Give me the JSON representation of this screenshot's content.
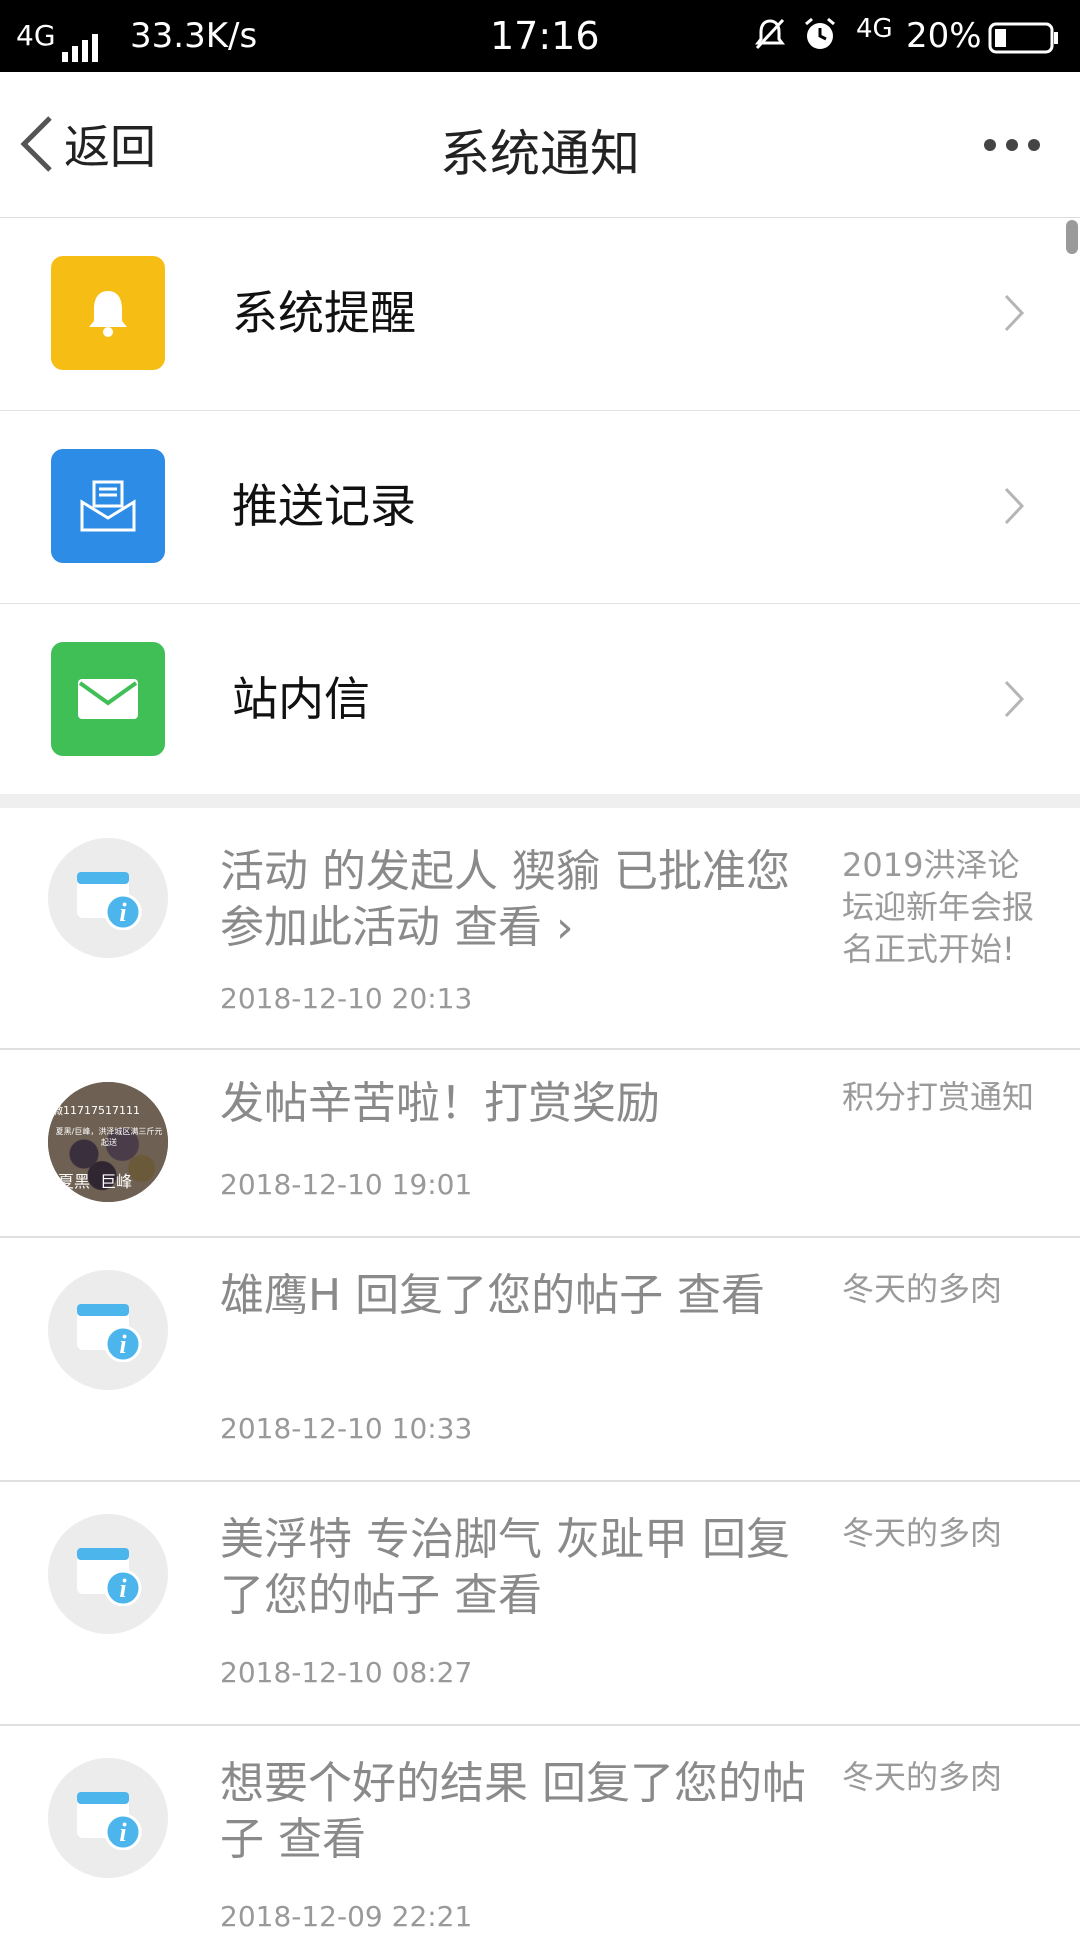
{
  "status_bar": {
    "network": "4G",
    "speed": "33.3K/s",
    "time": "17:16",
    "network2": "4G",
    "battery": "20%"
  },
  "nav": {
    "back_label": "返回",
    "title": "系统通知"
  },
  "entries": [
    {
      "label": "系统提醒",
      "icon": "bell-icon",
      "color": "#F6BE14"
    },
    {
      "label": "推送记录",
      "icon": "mail-open-icon",
      "color": "#2D8CE6"
    },
    {
      "label": "站内信",
      "icon": "envelope-icon",
      "color": "#3FBF55"
    }
  ],
  "notifications": [
    {
      "message": "活动 的发起人 猰貐 已批准您参加此活动 查看 ›",
      "time": "2018-12-10 20:13",
      "source": "2019洪泽论坛迎新年会报名正式开始!",
      "avatar": "info-calendar-icon"
    },
    {
      "message": "发帖辛苦啦！打赏奖励",
      "time": "2018-12-10 19:01",
      "source": "积分打赏通知",
      "avatar": "user-photo",
      "avatar_text_top": "微11717517111",
      "avatar_text_mid": "夏黑/巨峰，洪泽城区满三斤元起送",
      "avatar_text_bottom": "夏黑  巨峰"
    },
    {
      "message": "雄鹰H 回复了您的帖子  查看",
      "time": "2018-12-10 10:33",
      "source": "冬天的多肉",
      "avatar": "info-calendar-icon"
    },
    {
      "message": "美浮特 专治脚气 灰趾甲 回复了您的帖子 查看",
      "time": "2018-12-10 08:27",
      "source": "冬天的多肉",
      "avatar": "info-calendar-icon"
    },
    {
      "message": "想要个好的结果 回复了您的帖子 查看",
      "time": "2018-12-09 22:21",
      "source": "冬天的多肉",
      "avatar": "info-calendar-icon"
    }
  ]
}
